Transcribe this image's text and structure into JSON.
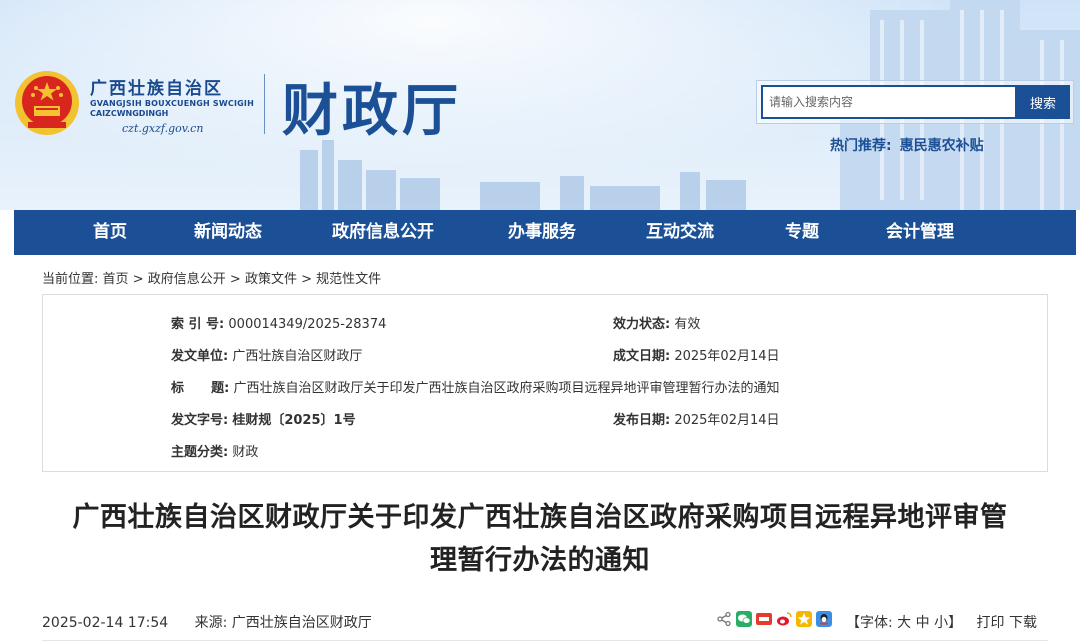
{
  "header": {
    "org_name_cn": "广西壮族自治区",
    "org_name_zhuang_1": "GVANGJSIH BOUXCUENGH SWCIGIH",
    "org_name_zhuang_2": "CAIZCWNGDINGH",
    "site_url": "czt.gxzf.gov.cn",
    "dept_title": "财政厅",
    "search_placeholder": "请输入搜索内容",
    "search_button": "搜索",
    "hot_label": "热门推荐:",
    "hot_link": "惠民惠农补贴"
  },
  "nav": {
    "items": [
      "首页",
      "新闻动态",
      "政府信息公开",
      "办事服务",
      "互动交流",
      "专题",
      "会计管理"
    ]
  },
  "breadcrumb": {
    "prefix": "当前位置:",
    "items": [
      "首页",
      "政府信息公开",
      "政策文件",
      "规范性文件"
    ],
    "separator": ">"
  },
  "meta": {
    "index_label": "索 引 号:",
    "index_value": "000014349/2025-28374",
    "status_label": "效力状态:",
    "status_value": "有效",
    "issuer_label": "发文单位:",
    "issuer_value": "广西壮族自治区财政厅",
    "created_label": "成文日期:",
    "created_value": "2025年02月14日",
    "title_label": "标      题:",
    "title_value": "广西壮族自治区财政厅关于印发广西壮族自治区政府采购项目远程异地评审管理暂行办法的通知",
    "docno_label": "发文字号:",
    "docno_value": "桂财规〔2025〕1号",
    "published_label": "发布日期:",
    "published_value": "2025年02月14日",
    "topic_label": "主题分类:",
    "topic_value": "财政"
  },
  "article": {
    "title_line1": "广西壮族自治区财政厅关于印发广西壮族自治区政府采购项目远程异地评审管",
    "title_line2": "理暂行办法的通知",
    "datetime": "2025-02-14 17:54",
    "source_label": "来源:",
    "source_value": "广西壮族自治区财政厅"
  },
  "tools": {
    "font_prefix": "【字体:",
    "font_large": "大",
    "font_medium": "中",
    "font_small": "小",
    "font_suffix": "】",
    "print": "打印",
    "download": "下载"
  },
  "colors": {
    "brand_blue": "#1b4f96",
    "emblem_red": "#d8261e",
    "emblem_gold": "#f2c230"
  }
}
